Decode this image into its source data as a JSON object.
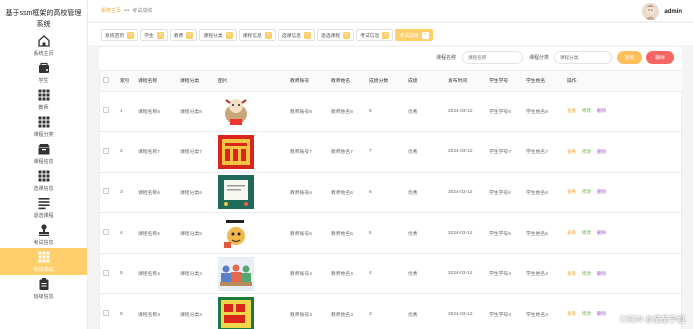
{
  "app": {
    "title": "基于ssm框架的高校管理系统"
  },
  "sidebar": {
    "items": [
      {
        "label": "系统主页",
        "icon": "home-icon"
      },
      {
        "label": "学生",
        "icon": "student-icon"
      },
      {
        "label": "教师",
        "icon": "grid-icon"
      },
      {
        "label": "课程分类",
        "icon": "grid-icon"
      },
      {
        "label": "课程信息",
        "icon": "box-icon"
      },
      {
        "label": "选课信息",
        "icon": "grid-icon"
      },
      {
        "label": "退选课程",
        "icon": "list-icon"
      },
      {
        "label": "考试信息",
        "icon": "stamp-icon"
      },
      {
        "label": "考试成绩",
        "icon": "grid-icon"
      },
      {
        "label": "班级信息",
        "icon": "clipboard-icon"
      }
    ],
    "active_index": 8
  },
  "breadcrumb": {
    "home": "系统主页",
    "separator": "•••",
    "current": "考试成绩"
  },
  "user": {
    "name": "admin"
  },
  "tags": [
    "系统首页",
    "学生",
    "教师",
    "课程分类",
    "课程信息",
    "选课信息",
    "退选课程",
    "考试信息",
    "考试成绩"
  ],
  "tags_active_index": 8,
  "search": {
    "course_name_label": "课程名称",
    "course_name_placeholder": "课程名称",
    "course_category_label": "课程分类",
    "course_category_placeholder": "课程分类",
    "search_button": "查询",
    "delete_button": "删除"
  },
  "table": {
    "headers": [
      "索引",
      "课程名称",
      "课程分类",
      "图片",
      "教师账号",
      "教师姓名",
      "成绩分数",
      "成绩",
      "发布时间",
      "学生学号",
      "学生姓名",
      "操作"
    ],
    "actions": {
      "detail": "查看",
      "edit": "修改",
      "delete": "删除"
    },
    "rows": [
      {
        "index": "1",
        "course": "课程名称8",
        "category": "课程分类8",
        "image": "cartoon-cat",
        "teacher_no": "教师账号8",
        "teacher_name": "教师姓名8",
        "score": "8",
        "grade": "优秀",
        "date": "2024-03-12",
        "student_no": "学生学号8",
        "student_name": "学生姓名8"
      },
      {
        "index": "2",
        "course": "课程名称7",
        "category": "课程分类7",
        "image": "red-poster",
        "teacher_no": "教师账号7",
        "teacher_name": "教师姓名7",
        "score": "7",
        "grade": "优秀",
        "date": "2024-03-12",
        "student_no": "学生学号7",
        "student_name": "学生姓名7"
      },
      {
        "index": "3",
        "course": "课程名称6",
        "category": "课程分类6",
        "image": "green-board",
        "teacher_no": "教师账号6",
        "teacher_name": "教师姓名6",
        "score": "6",
        "grade": "优秀",
        "date": "2024-03-12",
        "student_no": "学生学号6",
        "student_name": "学生姓名6"
      },
      {
        "index": "4",
        "course": "课程名称5",
        "category": "课程分类5",
        "image": "exam-cartoon",
        "teacher_no": "教师账号5",
        "teacher_name": "教师姓名5",
        "score": "5",
        "grade": "优秀",
        "date": "2024-03-12",
        "student_no": "学生学号5",
        "student_name": "学生姓名5"
      },
      {
        "index": "5",
        "course": "课程名称4",
        "category": "课程分类4",
        "image": "classroom",
        "teacher_no": "教师账号4",
        "teacher_name": "教师姓名4",
        "score": "4",
        "grade": "优秀",
        "date": "2024-03-12",
        "student_no": "学生学号4",
        "student_name": "学生姓名4"
      },
      {
        "index": "6",
        "course": "课程名称3",
        "category": "课程分类3",
        "image": "gaokao-poster",
        "teacher_no": "教师账号3",
        "teacher_name": "教师姓名3",
        "score": "3",
        "grade": "优秀",
        "date": "2024-03-12",
        "student_no": "学生学号3",
        "student_name": "学生姓名3"
      }
    ]
  },
  "watermark": "CSDN @茄茄学姐",
  "colors": {
    "accent": "#ffcf6b",
    "search_btn": "#ffbf5c",
    "delete_btn": "#f86565",
    "detail": "#f0a93b",
    "edit": "#6ab04c",
    "delete_link": "#9b59b6"
  }
}
